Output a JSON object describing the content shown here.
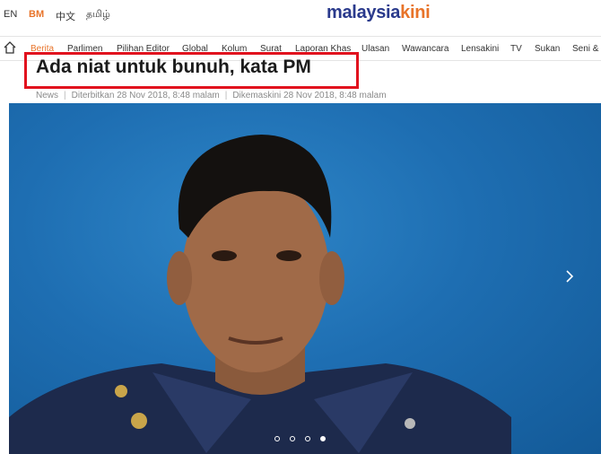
{
  "languages": [
    {
      "label": "EN",
      "active": false
    },
    {
      "label": "BM",
      "active": true
    },
    {
      "label": "中文",
      "active": false
    },
    {
      "label": "தமிழ்",
      "active": false
    }
  ],
  "logo": {
    "part1": "malaysia",
    "part2": "kini"
  },
  "nav": {
    "items": [
      {
        "label": "Berita",
        "active": true
      },
      {
        "label": "Parlimen"
      },
      {
        "label": "Pilihan Editor"
      },
      {
        "label": "Global"
      },
      {
        "label": "Kolum"
      },
      {
        "label": "Surat"
      },
      {
        "label": "Laporan Khas"
      },
      {
        "label": "Ulasan"
      },
      {
        "label": "Wawancara"
      },
      {
        "label": "Lensakini"
      },
      {
        "label": "TV"
      },
      {
        "label": "Sukan"
      },
      {
        "label": "Seni &"
      }
    ]
  },
  "article": {
    "headline": "Ada niat untuk bunuh, kata PM",
    "category": "News",
    "published": "Diterbitkan 28 Nov 2018, 8:48 malam",
    "updated": "Dikemaskini 28 Nov 2018, 8:48 malam"
  },
  "carousel": {
    "slides": 4,
    "active_index": 3
  },
  "colors": {
    "accent": "#e8742a",
    "brand": "#2a3a8c",
    "highlight_box": "#e1121e"
  }
}
